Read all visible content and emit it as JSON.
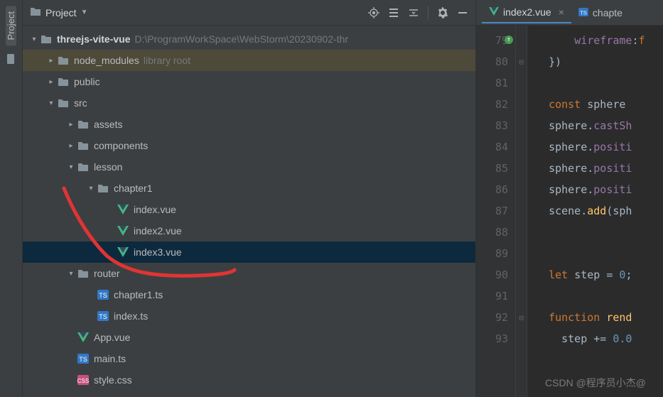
{
  "toolStrip": {
    "label": "Project"
  },
  "panel": {
    "title": "Project"
  },
  "tree": {
    "root": {
      "name": "threejs-vite-vue",
      "path": "D:\\ProgramWorkSpace\\WebStorm\\20230902-thr"
    },
    "node_modules": {
      "name": "node_modules",
      "hint": "library root"
    },
    "public": "public",
    "src": "src",
    "assets": "assets",
    "components": "components",
    "lesson": "lesson",
    "chapter1": "chapter1",
    "index_vue": "index.vue",
    "index2_vue": "index2.vue",
    "index3_vue": "index3.vue",
    "router": "router",
    "chapter1_ts": "chapter1.ts",
    "index_ts": "index.ts",
    "app_vue": "App.vue",
    "main_ts": "main.ts",
    "style_css": "style.css"
  },
  "editor": {
    "tabs": [
      {
        "label": "index2.vue",
        "icon": "vue",
        "active": true
      },
      {
        "label": "chapte",
        "icon": "ts",
        "active": false
      }
    ],
    "gutterStart": 79,
    "lines": [
      {
        "n": 79,
        "html": "      <span class='c-prop'>wireframe</span><span class='c-punc'>:</span><span class='c-key'>f</span>"
      },
      {
        "n": 80,
        "html": "  <span class='c-punc'>})</span>"
      },
      {
        "n": 81,
        "html": ""
      },
      {
        "n": 82,
        "html": "  <span class='c-key'>const</span> <span class='c-id'>sphere</span> "
      },
      {
        "n": 83,
        "html": "  <span class='c-id'>sphere</span>.<span class='c-prop'>castSh</span>"
      },
      {
        "n": 84,
        "html": "  <span class='c-id'>sphere</span>.<span class='c-prop'>positi</span>"
      },
      {
        "n": 85,
        "html": "  <span class='c-id'>sphere</span>.<span class='c-prop'>positi</span>"
      },
      {
        "n": 86,
        "html": "  <span class='c-id'>sphere</span>.<span class='c-prop'>positi</span>"
      },
      {
        "n": 87,
        "html": "  <span class='c-id'>scene</span>.<span class='c-fn'>add</span>(<span class='c-id'>sph</span>"
      },
      {
        "n": 88,
        "html": ""
      },
      {
        "n": 89,
        "html": ""
      },
      {
        "n": 90,
        "html": "  <span class='c-key'>let</span> <span class='c-id'>step</span> <span class='c-punc'>=</span> <span class='c-num'>0</span><span class='c-punc'>;</span>"
      },
      {
        "n": 91,
        "html": ""
      },
      {
        "n": 92,
        "html": "  <span class='c-key'>function</span> <span class='c-fn'>rend</span>"
      },
      {
        "n": 93,
        "html": "    <span class='c-id'>step</span> <span class='c-punc'>+=</span> <span class='c-num'>0.0</span>"
      }
    ]
  },
  "watermark": "CSDN @程序员小杰@"
}
